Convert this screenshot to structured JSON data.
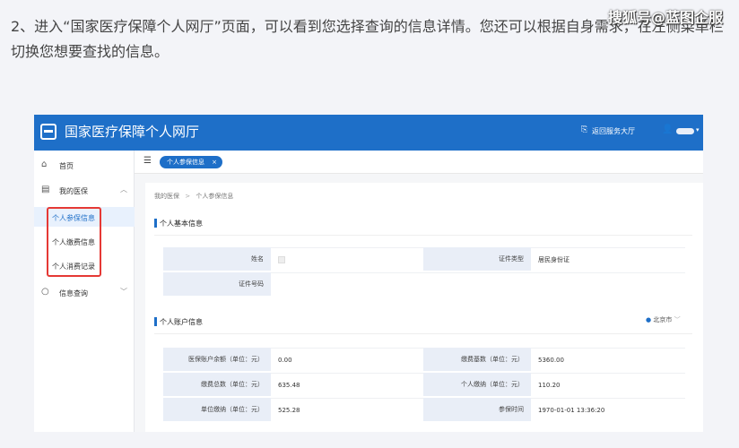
{
  "article": {
    "paragraph": "2、进入“国家医疗保障个人网厅”页面，可以看到您选择查询的信息详情。您还可以根据自身需求，在左侧菜单栏切换您想要查找的信息。"
  },
  "watermark": "搜狐号@蓝图企服",
  "app": {
    "title": "国家医疗保障个人网厅",
    "return_label": "返回服务大厅"
  },
  "sidebar": {
    "items": [
      {
        "label": "首页",
        "icon": "home-icon"
      },
      {
        "label": "我的医保",
        "icon": "document-icon"
      },
      {
        "label": "信息查询",
        "icon": "search-icon"
      }
    ],
    "sub_items": [
      {
        "label": "个人参保信息",
        "active": true
      },
      {
        "label": "个人缴费信息",
        "active": false
      },
      {
        "label": "个人消费记录",
        "active": false
      }
    ]
  },
  "tabs": {
    "active_label": "个人参保信息",
    "close_glyph": "×"
  },
  "breadcrumb": {
    "root": "我的医保",
    "separator": ">",
    "current": "个人参保信息"
  },
  "basic_info": {
    "title": "个人基本信息",
    "rows": [
      {
        "l1": "姓名",
        "v1": "",
        "l2": "证件类型",
        "v2": "居民身份证"
      },
      {
        "l1": "证件号码",
        "v1": "",
        "l2": "",
        "v2": ""
      }
    ]
  },
  "account_info": {
    "title": "个人账户信息",
    "city": "北京市",
    "rows": [
      {
        "l1": "医保账户余额（单位：元）",
        "v1": "0.00",
        "l2": "缴费基数（单位：元）",
        "v2": "5360.00"
      },
      {
        "l1": "缴费总数（单位：元）",
        "v1": "635.48",
        "l2": "个人缴纳（单位：元）",
        "v2": "110.20"
      },
      {
        "l1": "单位缴纳（单位：元）",
        "v1": "525.28",
        "l2": "参保时间",
        "v2": "1970-01-01 13:36:20"
      }
    ]
  },
  "colors": {
    "brand_blue": "#1e6fc8",
    "highlight_red": "#e53935"
  }
}
